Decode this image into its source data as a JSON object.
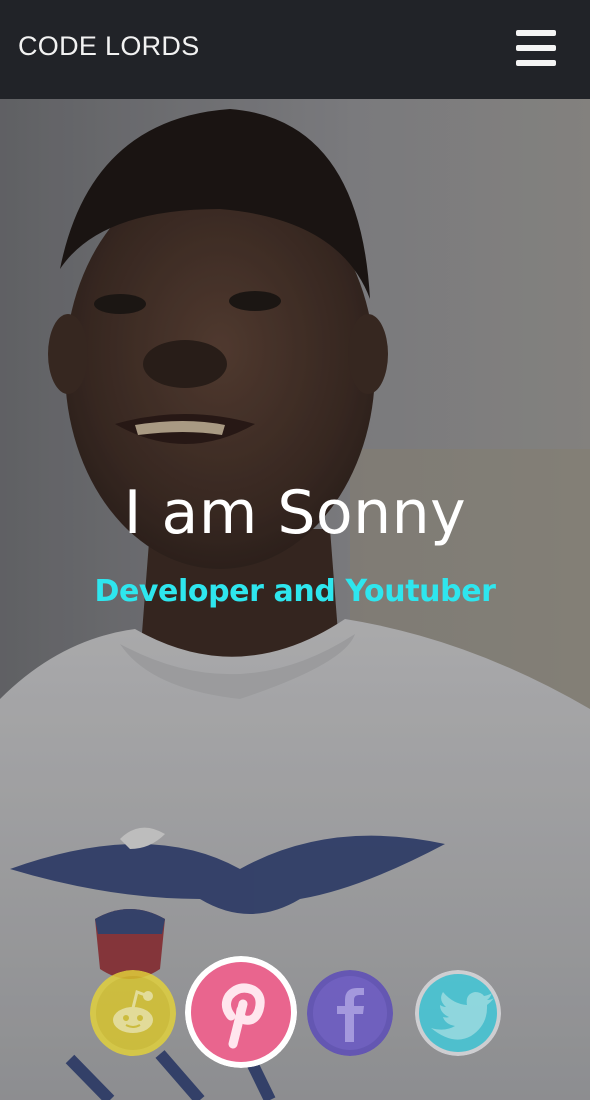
{
  "navbar": {
    "brand": "CODE LORDS",
    "menu_icon": "hamburger-menu-icon"
  },
  "hero": {
    "title": "I am Sonny",
    "subtitle": "Developer and Youtuber",
    "subtitle_color": "#2ee6ee",
    "background_photo": "portrait-photo"
  },
  "social": [
    {
      "name": "reddit",
      "icon": "reddit-icon",
      "color": "#e4d33a"
    },
    {
      "name": "pinterest",
      "icon": "pinterest-icon",
      "color": "#e9658e",
      "active": true
    },
    {
      "name": "facebook",
      "icon": "facebook-icon",
      "color": "#5d4db8"
    },
    {
      "name": "twitter",
      "icon": "twitter-icon",
      "color": "#43c8d8"
    }
  ],
  "colors": {
    "navbar_bg": "#212328",
    "title": "#ffffff",
    "accent": "#2ee6ee"
  }
}
